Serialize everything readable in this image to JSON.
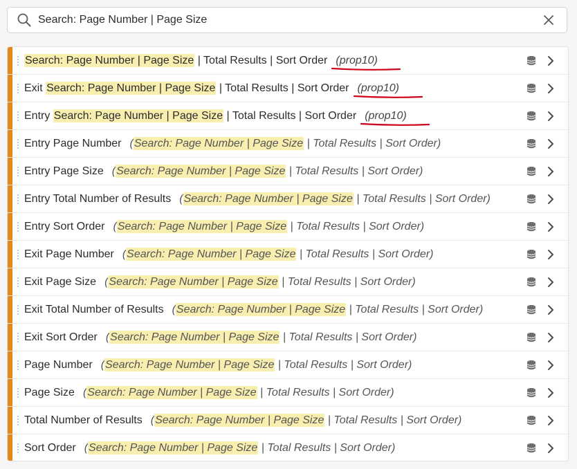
{
  "search": {
    "value": "Search: Page Number | Page Size"
  },
  "colors": {
    "accent": "#e68619",
    "highlight": "#f8eeb0",
    "annotation": "#d0021b"
  },
  "icons": {
    "search": "search-icon",
    "clear": "close-icon",
    "row_type": "database-icon",
    "row_action": "chevron-right-icon"
  },
  "rows": [
    {
      "name": [
        "Search: Page Number | Page Size",
        " | Total Results | Sort Order"
      ],
      "prop": "(prop10)",
      "desc": null
    },
    {
      "name": [
        "Exit ",
        "Search: Page Number | Page Size",
        " | Total Results | Sort Order"
      ],
      "prop": "(prop10)",
      "desc": null
    },
    {
      "name": [
        "Entry ",
        "Search: Page Number | Page Size",
        " | Total Results | Sort Order"
      ],
      "prop": "(prop10)",
      "desc": null
    },
    {
      "name": [
        "Entry Page Number"
      ],
      "desc": [
        "(",
        "Search: Page Number | Page Size",
        " | Total Results | Sort Order)"
      ]
    },
    {
      "name": [
        "Entry Page Size"
      ],
      "desc": [
        "(",
        "Search: Page Number | Page Size",
        " | Total Results | Sort Order)"
      ]
    },
    {
      "name": [
        "Entry Total Number of Results"
      ],
      "desc": [
        "(",
        "Search: Page Number | Page Size",
        " | Total Results | Sort Order)"
      ]
    },
    {
      "name": [
        "Entry Sort Order"
      ],
      "desc": [
        "(",
        "Search: Page Number | Page Size",
        " | Total Results | Sort Order)"
      ]
    },
    {
      "name": [
        "Exit Page Number"
      ],
      "desc": [
        "(",
        "Search: Page Number | Page Size",
        " | Total Results | Sort Order)"
      ]
    },
    {
      "name": [
        "Exit Page Size"
      ],
      "desc": [
        "(",
        "Search: Page Number | Page Size",
        " | Total Results | Sort Order)"
      ]
    },
    {
      "name": [
        "Exit Total Number of Results"
      ],
      "desc": [
        "(",
        "Search: Page Number | Page Size",
        " | Total Results | Sort Order)"
      ]
    },
    {
      "name": [
        "Exit Sort Order"
      ],
      "desc": [
        "(",
        "Search: Page Number | Page Size",
        " | Total Results | Sort Order)"
      ]
    },
    {
      "name": [
        "Page Number"
      ],
      "desc": [
        "(",
        "Search: Page Number | Page Size",
        " | Total Results | Sort Order)"
      ]
    },
    {
      "name": [
        "Page Size"
      ],
      "desc": [
        "(",
        "Search: Page Number | Page Size",
        " | Total Results | Sort Order)"
      ]
    },
    {
      "name": [
        "Total Number of Results"
      ],
      "desc": [
        "(",
        "Search: Page Number | Page Size",
        " | Total Results | Sort Order)"
      ]
    },
    {
      "name": [
        "Sort Order"
      ],
      "desc": [
        "(",
        "Search: Page Number | Page Size",
        " | Total Results | Sort Order)"
      ]
    }
  ]
}
